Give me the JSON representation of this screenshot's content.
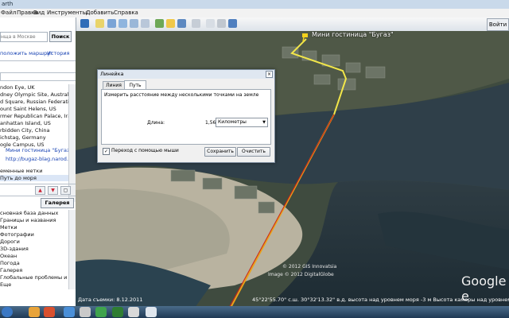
{
  "window": {
    "title": "arth"
  },
  "menu": [
    "Файл",
    "Правка",
    "Вид",
    "Инструменты",
    "Добавить",
    "Справка"
  ],
  "toolbar": {
    "signin_label": "Войти"
  },
  "search": {
    "placeholder": "нща в Москве",
    "button": "Поиск",
    "route_link": "положить маршрут",
    "history_link": "История"
  },
  "places": [
    "ndon Eye, UK",
    "dney Olympic Site, Australia",
    "d Square, Russian Federation",
    "ount Saint Helens, US",
    "rmer Republican Palace, Iraq",
    "anhattan Island, US",
    "rbidden City, China",
    "ichstag, Germany",
    "ogle Campus, US"
  ],
  "saved": {
    "hotel_link": "Мини гостиница \"Бугаз\"",
    "site_link": "http://bugaz-blag.narod.ru/",
    "temp_label": "еменные метки",
    "path_item": "Путь до моря"
  },
  "layers": {
    "gallery_button": "Галерея",
    "items": [
      "сновная база данных",
      "Границы и названия",
      "Метки",
      "Фотографии",
      "Дороги",
      "3D-здания",
      "Океан",
      "Погода",
      "Галерея",
      "Глобальные проблемы и ку",
      "Еще"
    ]
  },
  "map": {
    "placemark_label": "Мини гостиница \"Бугаз\"",
    "copyright": "© 2012 GIS Innovatsia",
    "copyright2": "Image © 2012 DigitalGlobe",
    "brand": "Google e",
    "status_date": "Дата съемки: 8.12.2011",
    "status_coords": "45°22'55.70\" с.ш. 30°32'13.32\" в.д.  высота над уровнем моря  -3 м   Высота камеры над уровнем моря"
  },
  "ruler": {
    "title": "Линейка",
    "tab_line": "Линия",
    "tab_path": "Путь",
    "description": "Измерить расстояние между несколькими точками на земле",
    "length_label": "Длина:",
    "length_value": "1,56",
    "unit": "Километры",
    "mouse_nav_label": "Переход с помощью мыши",
    "mouse_nav_checked": true,
    "save_button": "Сохранить",
    "clear_button": "Очистить"
  }
}
